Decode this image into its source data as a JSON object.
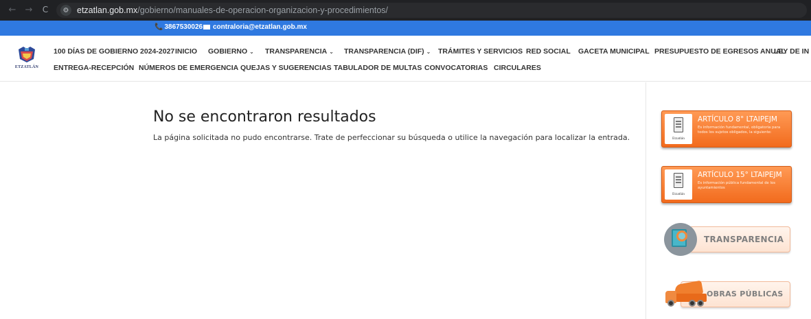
{
  "browser": {
    "back": "←",
    "forward": "→",
    "reload": "C",
    "site_info": "⚙",
    "url_domain": "etzatlan.gob.mx",
    "url_path": "/gobierno/manuales-de-operacion-organizacion-y-procedimientos/"
  },
  "topbar": {
    "phone_icon": "phone-icon",
    "phone": "3867530026",
    "mail_icon": "mail-icon",
    "email": "contraloria@etzatlan.gob.mx",
    "color": "#2f79e0"
  },
  "logo": {
    "text": "ETZATLÁN"
  },
  "menu": {
    "row1": [
      {
        "label": "100 DÍAS DE GOBIERNO 2024-2027",
        "dropdown": false
      },
      {
        "label": "INICIO",
        "dropdown": false
      },
      {
        "label": "GOBIERNO",
        "dropdown": true
      },
      {
        "label": "TRANSPARENCIA",
        "dropdown": true
      },
      {
        "label": "TRANSPARENCIA (DIF)",
        "dropdown": true
      },
      {
        "label": "TRÁMITES Y SERVICIOS",
        "dropdown": false
      },
      {
        "label": "RED SOCIAL",
        "dropdown": false
      },
      {
        "label": "GACETA MUNICIPAL",
        "dropdown": false
      },
      {
        "label": "PRESUPUESTO DE EGRESOS ANUAL",
        "dropdown": false
      },
      {
        "label": "LEY DE IN",
        "dropdown": false
      }
    ],
    "row2": [
      {
        "label": "ENTREGA-RECEPCIÓN"
      },
      {
        "label": "NÚMEROS DE EMERGENCIA"
      },
      {
        "label": "QUEJAS Y SUGERENCIAS"
      },
      {
        "label": "TABULADOR DE MULTAS"
      },
      {
        "label": "CONVOCATORIAS"
      },
      {
        "label": "CIRCULARES"
      }
    ],
    "caret": "⌄"
  },
  "main": {
    "title": "No se encontraron resultados",
    "message": "La página solicitada no pudo encontrarse. Trate de perfeccionar su búsqueda o utilice la navegación para localizar la entrada."
  },
  "sidebar": {
    "art8": {
      "badge_name": "Etzatlán",
      "title": "ARTÍCULO 8° LTAIPEJM",
      "description": "Es información fundamental, obligatoria para todos los sujetos obligados, la siguiente:"
    },
    "art15": {
      "badge_name": "Etzatlán",
      "title": "ARTÍCULO 15° LTAIPEJM",
      "description": "Es información pública fundamental de los ayuntamientos"
    },
    "transparencia": {
      "label": "TRANSPARENCIA"
    },
    "obras": {
      "label": "OBRAS PÚBLICAS"
    },
    "accent": "#f26b1d"
  }
}
